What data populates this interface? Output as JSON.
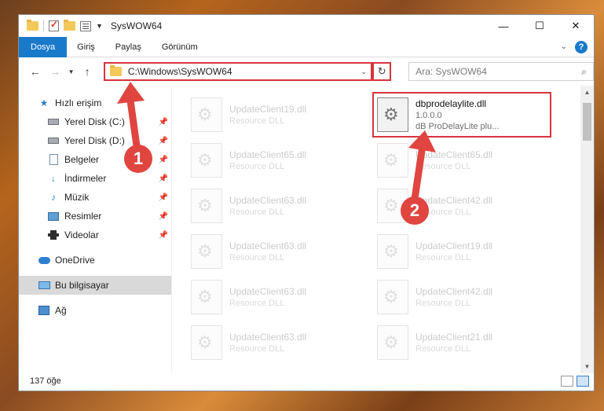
{
  "window": {
    "title": "SysWOW64",
    "controls": [
      "—",
      "☐",
      "✕"
    ]
  },
  "ribbon": {
    "tabs": [
      "Dosya",
      "Giriş",
      "Paylaş",
      "Görünüm"
    ],
    "help": "?"
  },
  "address": {
    "path": "C:\\Windows\\SysWOW64",
    "search_placeholder": "Ara: SysWOW64"
  },
  "nav": {
    "quick_access": "Hızlı erişim",
    "items": [
      {
        "label": "Yerel Disk (C:)",
        "icon": "disk-icon"
      },
      {
        "label": "Yerel Disk (D:)",
        "icon": "disk-icon"
      },
      {
        "label": "Belgeler",
        "icon": "documents-icon"
      },
      {
        "label": "İndirmeler",
        "icon": "download-icon"
      },
      {
        "label": "Müzik",
        "icon": "music-icon"
      },
      {
        "label": "Resimler",
        "icon": "pictures-icon"
      },
      {
        "label": "Videolar",
        "icon": "videos-icon"
      }
    ],
    "onedrive": "OneDrive",
    "this_pc": "Bu bilgisayar",
    "network": "Ağ"
  },
  "files": [
    {
      "name": "UpdateClient19.dll",
      "type": "Resource DLL"
    },
    {
      "name": "dbprodelaylite.dll",
      "type": "1.0.0.0",
      "desc": "dB ProDelayLite plu...",
      "highlight": true
    },
    {
      "name": "UpdateClient65.dll",
      "type": "Resource DLL"
    },
    {
      "name": "UpdateClient65.dll",
      "type": "Resource DLL"
    },
    {
      "name": "UpdateClient63.dll",
      "type": "Resource DLL"
    },
    {
      "name": "UpdateClient42.dll",
      "type": "Resource DLL"
    },
    {
      "name": "UpdateClient63.dll",
      "type": "Resource DLL"
    },
    {
      "name": "UpdateClient19.dll",
      "type": "Resource DLL"
    },
    {
      "name": "UpdateClient63.dll",
      "type": "Resource DLL"
    },
    {
      "name": "UpdateClient42.dll",
      "type": "Resource DLL"
    },
    {
      "name": "UpdateClient63.dll",
      "type": "Resource DLL"
    },
    {
      "name": "UpdateClient21.dll",
      "type": "Resource DLL"
    }
  ],
  "status": {
    "count": "137 öğe"
  },
  "annotations": {
    "step1": "1",
    "step2": "2",
    "color": "#e0453f"
  }
}
